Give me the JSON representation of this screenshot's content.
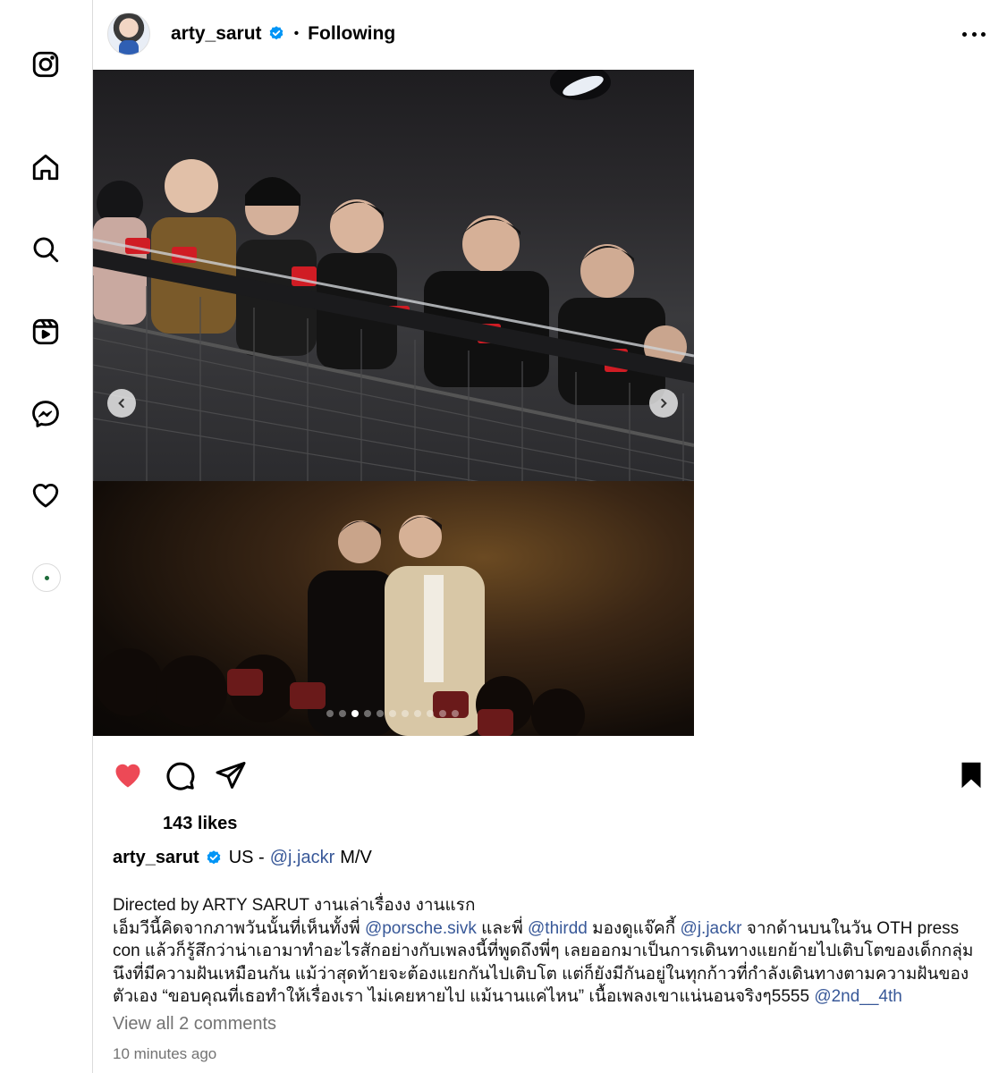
{
  "post": {
    "username": "arty_sarut",
    "separator": "•",
    "following": "Following",
    "likes": "143 likes",
    "caption": {
      "username": "arty_sarut",
      "prefix": "US -",
      "mention": "@j.jackr",
      "suffix": "M/V"
    },
    "body": {
      "line1": "Directed by ARTY SARUT งานเล่าเรื่องง งานแรก",
      "p1": "เอ็มวีนี้คิดจากภาพวันนั้นที่เห็นทั้งพี่ ",
      "m1": "@porsche.sivk",
      "p2": " และพี่ ",
      "m2": "@thirdd",
      "p3": " มองดูแจ๊คกี้ ",
      "m3": "@j.jackr",
      "p4": " จากด้านบนในวัน OTH press con แล้วก็รู้สึกว่าน่าเอามาทำอะไรสักอย่างกับเพลงนี้ที่พูดถึงพี่ๆ เลยออกมาเป็นการเดินทางแยกย้ายไปเติบโตของเด็กกลุ่มนึงที่มีความฝันเหมือนกัน แม้ว่าสุดท้ายจะต้องแยกกันไปเติบโต แต่ก็ยังมีกันอยู่ในทุกก้าวที่กำลังเดินทางตามความฝันของตัวเอง “ขอบคุณที่เธอทำให้เรื่องเรา ไม่เคยหายไป แม้นานแค่ไหน” เนื้อเพลงเขาแน่นอนจริงๆ5555 ",
      "m4": "@2nd__4th"
    },
    "view_all": "View all 2 comments",
    "time": "10 minutes ago"
  },
  "carousel": {
    "count": 11,
    "active_index": 2
  },
  "icons": {
    "sidebar": [
      "instagram-icon",
      "home-icon",
      "search-icon",
      "reels-icon",
      "messenger-icon",
      "heart-icon"
    ],
    "like_color": "#ed4956",
    "verified_color": "#0095f6",
    "mention_color": "#385898"
  }
}
